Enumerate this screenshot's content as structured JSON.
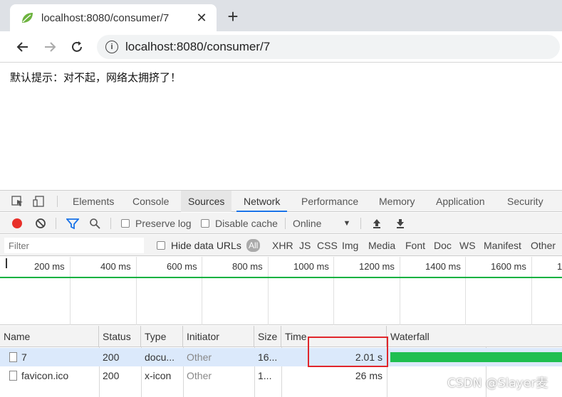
{
  "browser": {
    "tab_title": "localhost:8080/consumer/7",
    "tab_close": "✕",
    "new_tab": "+",
    "url": "localhost:8080/consumer/7",
    "info_icon": "i",
    "back_icon": "arrow-left",
    "forward_icon": "arrow-right",
    "reload_icon": "reload"
  },
  "page": {
    "message": "默认提示：对不起，网络太拥挤了！"
  },
  "devtools": {
    "tabs": [
      "Elements",
      "Console",
      "Sources",
      "Network",
      "Performance",
      "Memory",
      "Application",
      "Security"
    ],
    "active_tab": "Network",
    "network_toolbar": {
      "preserve_log": "Preserve log",
      "disable_cache": "Disable cache",
      "throttling": "Online"
    },
    "filter": {
      "placeholder": "Filter",
      "hide_data_urls": "Hide data URLs",
      "types": [
        "All",
        "XHR",
        "JS",
        "CSS",
        "Img",
        "Media",
        "Font",
        "Doc",
        "WS",
        "Manifest",
        "Other"
      ]
    },
    "overview_ticks": [
      "200 ms",
      "400 ms",
      "600 ms",
      "800 ms",
      "1000 ms",
      "1200 ms",
      "1400 ms",
      "1600 ms",
      "1"
    ],
    "columns": [
      "Name",
      "Status",
      "Type",
      "Initiator",
      "Size",
      "Time",
      "Waterfall"
    ],
    "rows": [
      {
        "name": "7",
        "status": "200",
        "type": "docu...",
        "initiator": "Other",
        "size": "16...",
        "time": "2.01 s"
      },
      {
        "name": "favicon.ico",
        "status": "200",
        "type": "x-icon",
        "initiator": "Other",
        "size": "1...",
        "time": "26 ms"
      }
    ]
  },
  "watermark": "CSDN @Slayer麦",
  "colors": {
    "record": "#e8302a",
    "active_tab_underline": "#1a73e8",
    "waterfall": "#1fbf50",
    "highlight": "#e0262b"
  }
}
